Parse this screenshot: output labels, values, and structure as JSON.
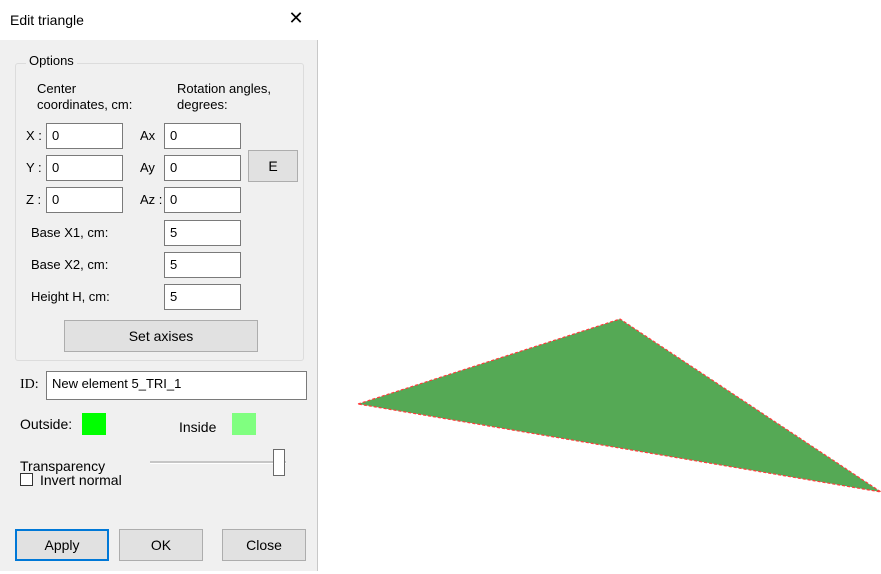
{
  "window": {
    "title": "Edit triangle"
  },
  "options": {
    "legend": "Options",
    "center_label_1": "Center",
    "center_label_2": "coordinates, cm:",
    "rotation_label_1": "Rotation angles,",
    "rotation_label_2": "degrees:",
    "x_label": "X :",
    "x_value": "0",
    "y_label": "Y :",
    "y_value": "0",
    "z_label": "Z :",
    "z_value": "0",
    "ax_label": "Ax",
    "ax_value": "0",
    "ay_label": "Ay",
    "ay_value": "0",
    "az_label": "Az :",
    "az_value": "0",
    "e_button": "E",
    "base_x1_label": "Base X1, cm:",
    "base_x1_value": "5",
    "base_x2_label": "Base X2, cm:",
    "base_x2_value": "5",
    "height_label": "Height H, cm:",
    "height_value": "5",
    "set_axises_button": "Set axises"
  },
  "id_field": {
    "label": "ID:",
    "value": "New element 5_TRI_1"
  },
  "colors": {
    "outside_label": "Outside:",
    "outside_color": "#00ff00",
    "inside_label": "Inside",
    "inside_color": "#80ff80",
    "triangle_fill": "#55a955",
    "triangle_edge": "#ff3b3b"
  },
  "transparency": {
    "label": "Transparency",
    "level": 1.0
  },
  "invert_normal": {
    "label": "Invert normal",
    "checked": false
  },
  "buttons": {
    "apply": "Apply",
    "ok": "OK",
    "close": "Close"
  }
}
